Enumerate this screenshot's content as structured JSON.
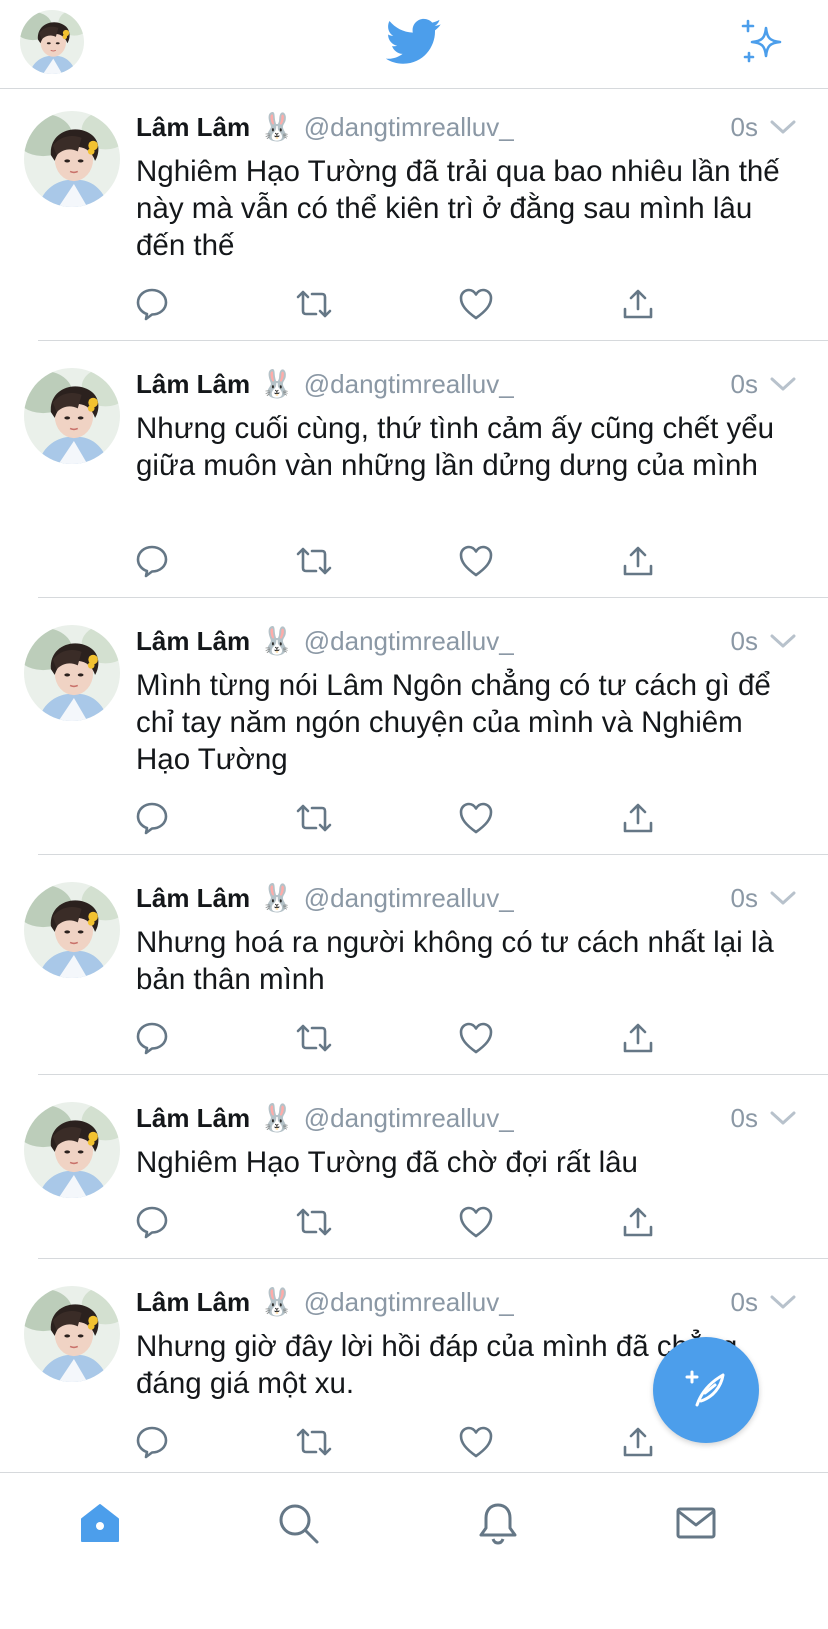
{
  "header": {
    "avatar_icon": "profile-avatar",
    "logo_icon": "twitter-bird-icon",
    "sparkle_icon": "sparkle-icon",
    "accent_color": "#4c9eeb"
  },
  "tweets": [
    {
      "name": "Lâm Lâm",
      "emoji": "🐰",
      "handle": "@dangtimrealluv_",
      "time": "0s",
      "text": "Nghiêm Hạo Tường đã trải qua bao nhiêu lần thế này mà vẫn có thể kiên trì ở đằng sau mình lâu đến thế"
    },
    {
      "name": "Lâm Lâm",
      "emoji": "🐰",
      "handle": "@dangtimrealluv_",
      "time": "0s",
      "text": "Nhưng cuối cùng, thứ tình cảm ấy cũng chết yểu giữa muôn vàn những lần dửng dưng của mình"
    },
    {
      "name": "Lâm Lâm",
      "emoji": "🐰",
      "handle": "@dangtimrealluv_",
      "time": "0s",
      "text": "Mình từng nói Lâm Ngôn chẳng có tư cách gì để chỉ tay năm ngón chuyện của mình và Nghiêm Hạo Tường"
    },
    {
      "name": "Lâm Lâm",
      "emoji": "🐰",
      "handle": "@dangtimrealluv_",
      "time": "0s",
      "text": "Nhưng hoá ra người không có tư cách nhất lại là bản thân mình"
    },
    {
      "name": "Lâm Lâm",
      "emoji": "🐰",
      "handle": "@dangtimrealluv_",
      "time": "0s",
      "text": "Nghiêm Hạo Tường đã chờ đợi rất lâu"
    },
    {
      "name": "Lâm Lâm",
      "emoji": "🐰",
      "handle": "@dangtimrealluv_",
      "time": "0s",
      "text": "Nhưng giờ đây lời hồi đáp của mình đã chẳng đáng giá một xu."
    }
  ],
  "fab": {
    "icon": "compose-feather-icon"
  },
  "tabbar": {
    "items": [
      {
        "icon": "home-icon",
        "active": true
      },
      {
        "icon": "search-icon",
        "active": false
      },
      {
        "icon": "bell-icon",
        "active": false
      },
      {
        "icon": "mail-icon",
        "active": false
      }
    ]
  }
}
